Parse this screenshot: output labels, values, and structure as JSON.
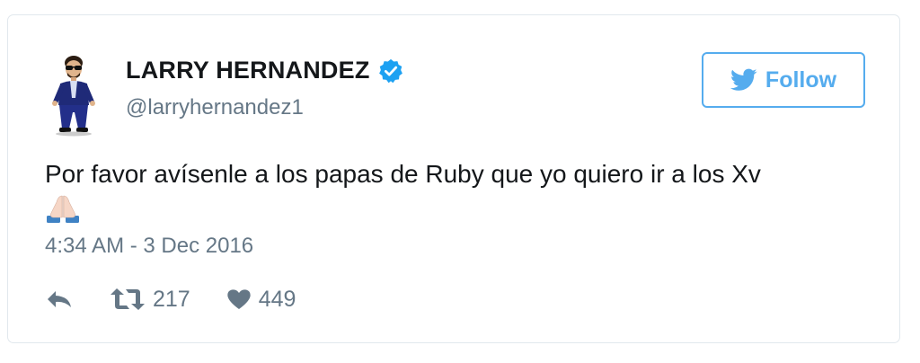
{
  "author": {
    "name": "LARRY HERNANDEZ",
    "handle": "@larryhernandez1",
    "verified": true
  },
  "follow_button": {
    "label": "Follow",
    "icon": "twitter-bird-icon"
  },
  "tweet": {
    "text": "Por favor avísenle a los papas de Ruby que yo quiero ir a los Xv",
    "emoji": "folded-hands-icon",
    "timestamp": "4:34 AM - 3 Dec 2016"
  },
  "actions": {
    "reply_icon": "reply-icon",
    "retweet_icon": "retweet-icon",
    "retweet_count": "217",
    "like_icon": "heart-icon",
    "like_count": "449"
  },
  "colors": {
    "accent": "#55acee",
    "text": "#14171a",
    "secondary": "#657786",
    "verified": "#1da1f2",
    "border": "#e1e8ed"
  }
}
